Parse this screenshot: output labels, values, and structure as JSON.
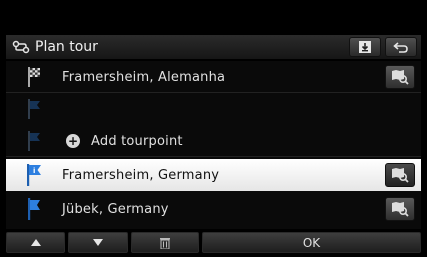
{
  "header": {
    "title": "Plan tour",
    "title_icon": "route-icon",
    "download_icon": "download-icon",
    "back_icon": "back-arrow-icon"
  },
  "list": {
    "rows": [
      {
        "label": "Framersheim, Alemanha",
        "flag": "checkered-flag-icon",
        "map_button": true
      },
      {
        "label": "",
        "flag": "blue-flag-icon",
        "map_button": false
      },
      {
        "label": "Add tourpoint",
        "flag": "blue-flag-icon",
        "map_button": false
      },
      {
        "label": "Framersheim, Germany",
        "flag": "blue-flag-icon",
        "map_button": true,
        "selected": true
      },
      {
        "label": "Jübek, Germany",
        "flag": "blue-flag-icon",
        "map_button": true
      }
    ],
    "add_icon": "plus-circle-icon",
    "map_icon": "map-search-icon"
  },
  "toolbar": {
    "up_icon": "triangle-up-icon",
    "down_icon": "triangle-down-icon",
    "delete_icon": "trash-icon",
    "ok_label": "OK"
  },
  "colors": {
    "selected_row": "#ffffff",
    "flag_blue": "#2d7fe0",
    "background": "#000000"
  }
}
